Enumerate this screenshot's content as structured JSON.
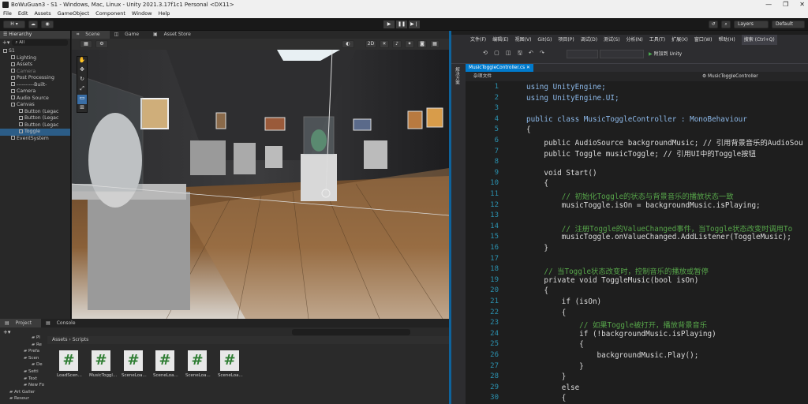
{
  "window": {
    "title": "BoWuGuan3 - S1 - Windows, Mac, Linux - Unity 2021.3.17f1c1 Personal <DX11>",
    "controls": [
      "—",
      "❐",
      "✕"
    ]
  },
  "menu": [
    "File",
    "Edit",
    "Assets",
    "GameObject",
    "Component",
    "Window",
    "Help"
  ],
  "toolbar": {
    "account": "H ▾",
    "layers": "Layers",
    "layout": "Default"
  },
  "hierarchy": {
    "tab": "Hierarchy",
    "search": "All",
    "items": [
      {
        "label": "S1",
        "depth": 0
      },
      {
        "label": "Lighting",
        "depth": 1
      },
      {
        "label": "Assets",
        "depth": 1
      },
      {
        "label": "Camera",
        "depth": 1
      },
      {
        "label": "Post Processing",
        "depth": 1
      },
      {
        "label": "----------Built-",
        "depth": 1
      },
      {
        "label": "Camera",
        "depth": 1
      },
      {
        "label": "Audio Source",
        "depth": 1
      },
      {
        "label": "Canvas",
        "depth": 1
      },
      {
        "label": "Button (Legac",
        "depth": 2
      },
      {
        "label": "Button (Legac",
        "depth": 2
      },
      {
        "label": "Button (Legac",
        "depth": 2
      },
      {
        "label": "Toggle",
        "depth": 2
      },
      {
        "label": "EventSystem",
        "depth": 1
      }
    ]
  },
  "scene": {
    "tabs": [
      "Scene",
      "Game",
      "Asset Store"
    ],
    "mode_2d": "2D"
  },
  "project": {
    "tabs": [
      "Project",
      "Console"
    ],
    "breadcrumb": "Assets › Scripts",
    "tree": [
      "Pl",
      "Re",
      "Prefa",
      "Scen",
      "De",
      "Setti",
      "Text",
      "New Fo",
      "Art Galler",
      "Resour"
    ],
    "files": [
      "LoadScen...",
      "MusicToggl...",
      "SceneLoa...",
      "SceneLoa...",
      "SceneLoa...",
      "SceneLoa..."
    ]
  },
  "vs": {
    "menu": [
      "文件(F)",
      "编辑(E)",
      "视图(V)",
      "Git(G)",
      "项目(P)",
      "调试(D)",
      "测试(S)",
      "分析(N)",
      "工具(T)",
      "扩展(X)",
      "窗口(W)",
      "帮助(H)",
      "搜索 (Ctrl+Q)"
    ],
    "run_label": "附加到 Unity",
    "tab": "MusicToggleController.cs",
    "nav_left": "杂项文件",
    "nav_right": "MusicToggleController",
    "side_label": "解决方案",
    "code": [
      {
        "n": "1",
        "t": "using UnityEngine;"
      },
      {
        "n": "2",
        "t": "using UnityEngine.UI;"
      },
      {
        "n": "3",
        "t": ""
      },
      {
        "n": "4",
        "t": "public class MusicToggleController : MonoBehaviour"
      },
      {
        "n": "5",
        "t": "{"
      },
      {
        "n": "6",
        "t": "    public AudioSource backgroundMusic; // 引用背景音乐的AudioSou"
      },
      {
        "n": "7",
        "t": "    public Toggle musicToggle; // 引用UI中的Toggle按钮"
      },
      {
        "n": "8",
        "t": ""
      },
      {
        "n": "9",
        "t": "    void Start()"
      },
      {
        "n": "10",
        "t": "    {"
      },
      {
        "n": "11",
        "t": "        // 初始化Toggle的状态与背景音乐的播放状态一致"
      },
      {
        "n": "12",
        "t": "        musicToggle.isOn = backgroundMusic.isPlaying;"
      },
      {
        "n": "13",
        "t": ""
      },
      {
        "n": "14",
        "t": "        // 注册Toggle的ValueChanged事件，当Toggle状态改变时调用To"
      },
      {
        "n": "15",
        "t": "        musicToggle.onValueChanged.AddListener(ToggleMusic);"
      },
      {
        "n": "16",
        "t": "    }"
      },
      {
        "n": "17",
        "t": ""
      },
      {
        "n": "18",
        "t": "    // 当Toggle状态改变时，控制音乐的播放或暂停"
      },
      {
        "n": "19",
        "t": "    private void ToggleMusic(bool isOn)"
      },
      {
        "n": "20",
        "t": "    {"
      },
      {
        "n": "21",
        "t": "        if (isOn)"
      },
      {
        "n": "22",
        "t": "        {"
      },
      {
        "n": "23",
        "t": "            // 如果Toggle被打开，播放背景音乐"
      },
      {
        "n": "24",
        "t": "            if (!backgroundMusic.isPlaying)"
      },
      {
        "n": "25",
        "t": "            {"
      },
      {
        "n": "26",
        "t": "                backgroundMusic.Play();"
      },
      {
        "n": "27",
        "t": "            }"
      },
      {
        "n": "28",
        "t": "        }"
      },
      {
        "n": "29",
        "t": "        else"
      },
      {
        "n": "30",
        "t": "        {"
      }
    ]
  }
}
